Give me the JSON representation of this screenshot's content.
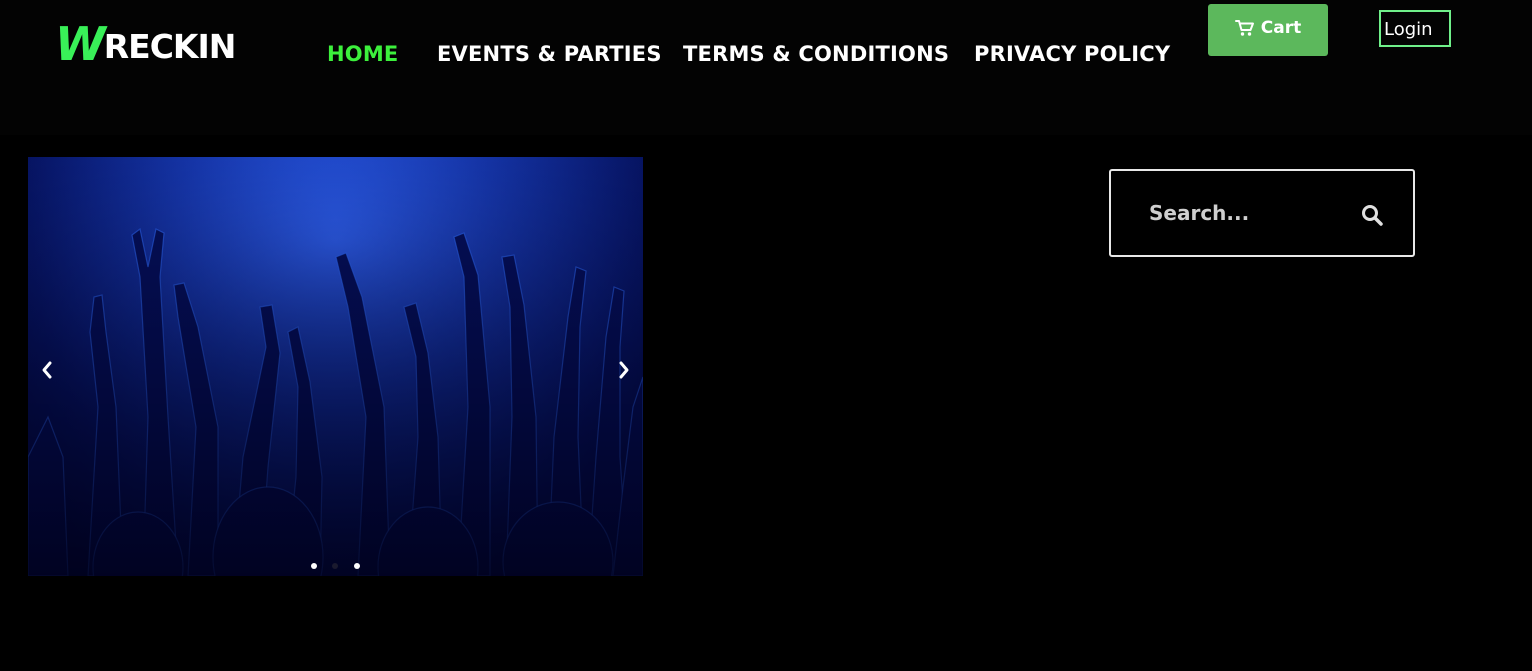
{
  "brand": {
    "logo_initial": "W",
    "logo_rest": "RECKIN",
    "accent_color": "#39f058"
  },
  "nav": {
    "items": [
      {
        "label": "HOME",
        "active": true
      },
      {
        "label": "EVENTS & PARTIES",
        "active": false
      },
      {
        "label": "TERMS & CONDITIONS",
        "active": false
      },
      {
        "label": "PRIVACY POLICY",
        "active": false
      }
    ],
    "active_color": "#3cf03c"
  },
  "header_actions": {
    "cart_label": "Cart",
    "cart_icon": "cart-icon",
    "cart_color": "#5cb85c",
    "login_label": "Login",
    "login_border_color": "#6ff08a"
  },
  "slider": {
    "prev_icon": "chevron-left-icon",
    "next_icon": "chevron-right-icon",
    "slide_count": 3,
    "active_slide": 1
  },
  "search": {
    "placeholder": "Search...",
    "value": "",
    "icon": "search-icon"
  }
}
